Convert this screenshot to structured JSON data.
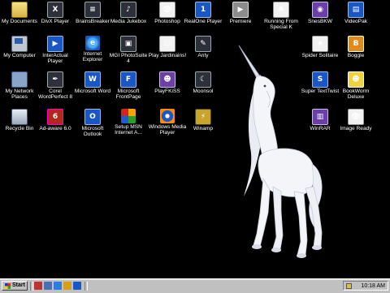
{
  "desktop": {
    "icons": [
      {
        "label": "My Documents",
        "icon": "folder-icon",
        "look": "g-folder",
        "badge": ""
      },
      {
        "label": "DivX Player",
        "icon": "divx-icon",
        "look": "g-dark",
        "badge": "X"
      },
      {
        "label": "BrainsBreaker",
        "icon": "puzzle-icon",
        "look": "g-dark",
        "badge": "≡"
      },
      {
        "label": "Media Jukebox",
        "icon": "jukebox-icon",
        "look": "g-dark",
        "badge": "♪"
      },
      {
        "label": "Photoshop",
        "icon": "photoshop-icon",
        "look": "g-white",
        "badge": "👁"
      },
      {
        "label": "RealOne Player",
        "icon": "realone-icon",
        "look": "g-blue",
        "badge": "1"
      },
      {
        "label": "Premiere",
        "icon": "premiere-icon",
        "look": "g-grey",
        "badge": "▶"
      },
      {
        "label": "Running From Special K",
        "icon": "clover-icon",
        "look": "g-white",
        "badge": "♣"
      },
      {
        "label": "SnesBKW",
        "icon": "snes-icon",
        "look": "g-purple",
        "badge": "◉"
      },
      {
        "label": "VideoPak",
        "icon": "videopak-icon",
        "look": "g-blue",
        "badge": "▤"
      },
      {
        "label": "My Computer",
        "icon": "computer-icon",
        "look": "g-pc",
        "badge": ""
      },
      {
        "label": "InterActual Player",
        "icon": "interactual-icon",
        "look": "g-blue",
        "badge": "▶"
      },
      {
        "label": "Internet Explorer",
        "icon": "ie-icon",
        "look": "g-ie",
        "badge": "e"
      },
      {
        "label": "MGI PhotoSuite 4",
        "icon": "photosuite-icon",
        "look": "g-dark",
        "badge": "▣"
      },
      {
        "label": "Play Jardinains!",
        "icon": "jardinains-icon",
        "look": "g-white",
        "badge": "☺"
      },
      {
        "label": "Anty",
        "icon": "anty-icon",
        "look": "g-dark",
        "badge": "✎"
      },
      {
        "label": "Spider Solitaire",
        "icon": "spider-solitaire-icon",
        "look": "g-white",
        "badge": "♠"
      },
      {
        "label": "Boggle",
        "icon": "boggle-icon",
        "look": "g-orange",
        "badge": "B"
      },
      {
        "label": "My Network Places",
        "icon": "network-icon",
        "look": "g-net",
        "badge": ""
      },
      {
        "label": "Corel WordPerfect 8",
        "icon": "wordperfect-icon",
        "look": "g-dark",
        "badge": "✒"
      },
      {
        "label": "Microsoft Word",
        "icon": "word-icon",
        "look": "g-blue",
        "badge": "W"
      },
      {
        "label": "Microsoft FrontPage",
        "icon": "frontpage-icon",
        "look": "g-blue",
        "badge": "F"
      },
      {
        "label": "PlayFKiSS",
        "icon": "fkiss-icon",
        "look": "g-purple",
        "badge": "☻"
      },
      {
        "label": "Moonsol",
        "icon": "moonsol-icon",
        "look": "g-dark",
        "badge": "☾"
      },
      {
        "label": "Super TextTwist",
        "icon": "texttwist-icon",
        "look": "g-blue",
        "badge": "S"
      },
      {
        "label": "BookWorm Deluxe",
        "icon": "bookworm-icon",
        "look": "g-yellow",
        "badge": "☻"
      },
      {
        "label": "Recycle Bin",
        "icon": "recycle-bin-icon",
        "look": "g-bin",
        "badge": ""
      },
      {
        "label": "Ad-aware 6.0",
        "icon": "adaware-icon",
        "look": "g-red",
        "badge": "6"
      },
      {
        "label": "Microsoft Outlook",
        "icon": "outlook-icon",
        "look": "g-blue",
        "badge": "O"
      },
      {
        "label": "Setup MSN Internet A...",
        "icon": "msn-icon",
        "look": "g-msn",
        "badge": ""
      },
      {
        "label": "Windows Media Player",
        "icon": "media-player-icon",
        "look": "g-media",
        "badge": ""
      },
      {
        "label": "Winamp",
        "icon": "winamp-icon",
        "look": "g-winamp",
        "badge": "⚡"
      },
      {
        "label": "WinRAR",
        "icon": "winrar-icon",
        "look": "g-purple",
        "badge": "▥"
      },
      {
        "label": "Image Ready",
        "icon": "imageready-icon",
        "look": "g-white",
        "badge": "👁"
      }
    ]
  },
  "taskbar": {
    "start_label": "Start",
    "quick_launch": [
      {
        "icon": "quicklaunch-app-icon",
        "color": "#b33"
      },
      {
        "icon": "show-desktop-icon",
        "color": "#4a6fb5"
      },
      {
        "icon": "ie-quicklaunch-icon",
        "color": "#2a7de1"
      },
      {
        "icon": "outlook-express-icon",
        "color": "#d4a017"
      },
      {
        "icon": "quicklaunch-media-icon",
        "color": "#1b56c7"
      }
    ],
    "clock": "10:18 AM"
  }
}
